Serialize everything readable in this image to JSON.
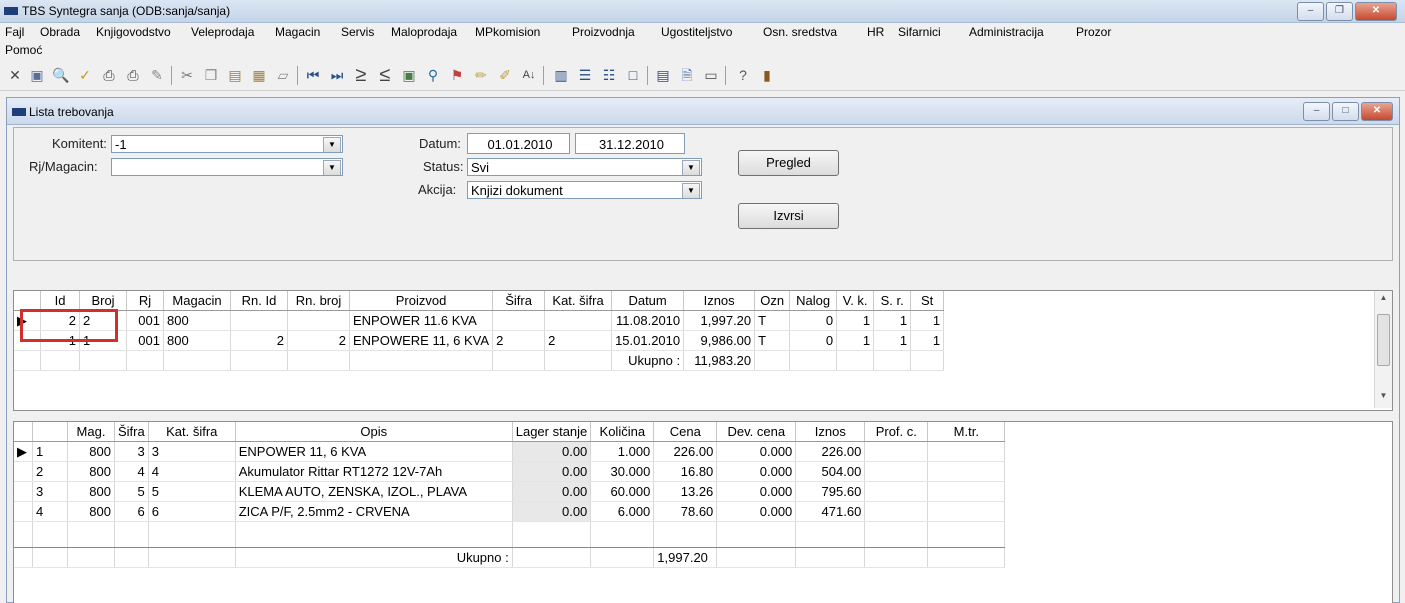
{
  "app": {
    "title": "TBS Syntegra sanja   (ODB:sanja/sanja)",
    "window_buttons": {
      "minimize": "–",
      "maximize": "❐",
      "close": "✕"
    }
  },
  "menu": {
    "row1": [
      "Fajl",
      "Obrada",
      "Knjigovodstvo",
      "Veleprodaja",
      "Magacin",
      "Servis",
      "Maloprodaja",
      "MPkomision",
      "Proizvodnja",
      "Ugostiteljstvo",
      "Osn. sredstva",
      "HR",
      "Sifarnici",
      "Administracija",
      "Prozor"
    ],
    "row2": [
      "Pomoć"
    ]
  },
  "toolbar": {
    "icons": [
      "close-icon",
      "save-icon",
      "print-preview-icon",
      "check-icon",
      "print-icon",
      "printer-icon",
      "tools-icon",
      "cut-icon",
      "copy-icon",
      "paste-icon",
      "calculator-icon",
      "pen-icon",
      "first-icon",
      "last-icon",
      "greater-icon",
      "less-icon",
      "refresh-icon",
      "tree-icon",
      "flag-icon",
      "pencil-icon",
      "pencils-icon",
      "sort-icon",
      "columns-icon",
      "rows-icon",
      "list-icon",
      "window-icon",
      "grid-icon",
      "document-icon",
      "form-icon",
      "help-icon",
      "exit-icon"
    ]
  },
  "child_window": {
    "title": "Lista trebovanja",
    "buttons": {
      "minimize": "–",
      "maximize": "□",
      "close": "✕"
    }
  },
  "filters": {
    "komitent_label": "Komitent:",
    "komitent_value": "-1",
    "rj_label": "Rj/Magacin:",
    "rj_value": "",
    "datum_label": "Datum:",
    "datum_from": "01.01.2010",
    "datum_to": "31.12.2010",
    "status_label": "Status:",
    "status_value": "Svi",
    "akcija_label": "Akcija:",
    "akcija_value": "Knjizi dokument",
    "pregled_button": "Pregled",
    "izvrsi_button": "Izvrsi"
  },
  "upper_grid": {
    "columns": [
      "Id",
      "Broj",
      "Rj",
      "Magacin",
      "Rn. Id",
      "Rn. broj",
      "Proizvod",
      "Šifra",
      "Kat. šifra",
      "Datum",
      "Iznos",
      "Ozn",
      "Nalog",
      "V. k.",
      "S. r.",
      "St"
    ],
    "rows": [
      {
        "marker": "▶",
        "cells": [
          "2",
          "2",
          "001",
          "800",
          "",
          "",
          "ENPOWER 11.6 KVA",
          "",
          "",
          "11.08.2010",
          "1,997.20",
          "T",
          "0",
          "1",
          "1",
          "1"
        ]
      },
      {
        "marker": "",
        "cells": [
          "1",
          "1",
          "001",
          "800",
          "2",
          "2",
          "ENPOWERE 11, 6 KVA",
          "2",
          "2",
          "15.01.2010",
          "9,986.00",
          "T",
          "0",
          "1",
          "1",
          "1"
        ]
      }
    ],
    "total_label": "Ukupno :",
    "total_value": "11,983.20"
  },
  "lower_grid": {
    "columns": [
      "",
      "Mag.",
      "Šifra",
      "Kat. šifra",
      "Opis",
      "Lager stanje",
      "Količina",
      "Cena",
      "Dev. cena",
      "Iznos",
      "Prof. c.",
      "M.tr."
    ],
    "rows": [
      {
        "marker": "▶",
        "cells": [
          "1",
          "800",
          "3",
          "3",
          "ENPOWER 11, 6 KVA",
          "0.00",
          "1.000",
          "226.00",
          "0.000",
          "226.00",
          "",
          ""
        ]
      },
      {
        "marker": "",
        "cells": [
          "2",
          "800",
          "4",
          "4",
          "Akumulator  Rittar RT1272 12V-7Ah",
          "0.00",
          "30.000",
          "16.80",
          "0.000",
          "504.00",
          "",
          ""
        ]
      },
      {
        "marker": "",
        "cells": [
          "3",
          "800",
          "5",
          "5",
          "KLEMA AUTO, ZENSKA, IZOL., PLAVA",
          "0.00",
          "60.000",
          "13.26",
          "0.000",
          "795.60",
          "",
          ""
        ]
      },
      {
        "marker": "",
        "cells": [
          "4",
          "800",
          "6",
          "6",
          "ZICA P/F, 2.5mm2 - CRVENA",
          "0.00",
          "6.000",
          "78.60",
          "0.000",
          "471.60",
          "",
          ""
        ]
      }
    ],
    "total_label": "Ukupno :",
    "total_value": "1,997.20"
  },
  "highlight_color": "#d12e2e"
}
